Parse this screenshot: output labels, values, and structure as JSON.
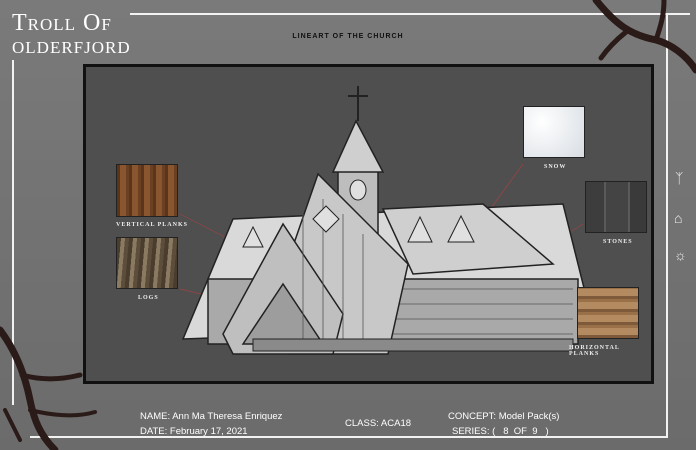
{
  "header": {
    "title_line1": "Troll Of",
    "title_line2": "OLDERFJORD",
    "subtitle": "LINEART OF THE CHURCH"
  },
  "materials": [
    {
      "id": "vertical",
      "label": "Vertical planks",
      "color": "#7b4a27"
    },
    {
      "id": "logs",
      "label": "Logs",
      "color": "#6a5a45"
    },
    {
      "id": "snow",
      "label": "snow",
      "color": "#e8ecf0"
    },
    {
      "id": "stones",
      "label": "stones",
      "color": "#4a4a4a"
    },
    {
      "id": "horizontal",
      "label": "Horizontal planks",
      "color": "#a87a52"
    }
  ],
  "footer": {
    "name_key": "NAME:",
    "name_val": "Ann Ma Theresa Enriquez",
    "date_key": "DATE:",
    "date_val": "February 17, 2021",
    "class_key": "CLASS:",
    "class_val": "ACA18",
    "concept_key": "CONCEPT:",
    "concept_val": "Model Pack(s)",
    "series_key": "SERIES:",
    "series_val": "(   8  OF  9   )"
  },
  "side_icons": [
    "rune-icon",
    "house-icon",
    "sun-icon"
  ]
}
